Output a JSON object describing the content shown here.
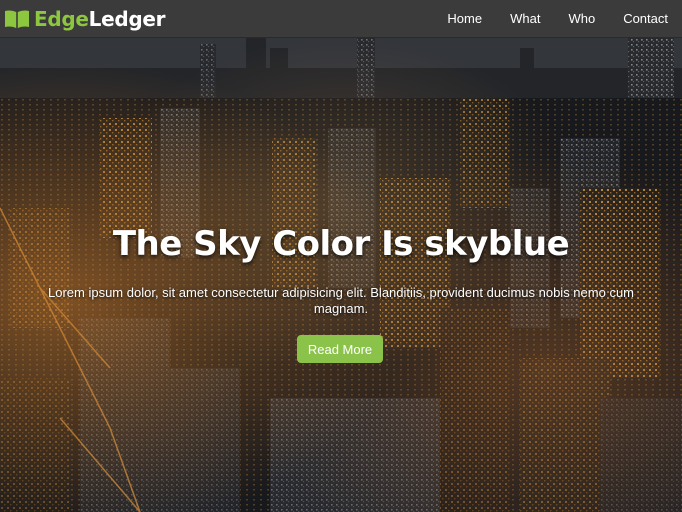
{
  "brand": {
    "icon": "open-book-icon",
    "name_part_1": "Edge",
    "name_part_2": "Ledger",
    "color_part_1": "#8dc63f",
    "color_part_2": "#ffffff"
  },
  "nav": {
    "items": [
      {
        "label": "Home"
      },
      {
        "label": "What"
      },
      {
        "label": "Who"
      },
      {
        "label": "Contact"
      }
    ]
  },
  "hero": {
    "background": "night city skyline aerial photo",
    "title": "The Sky Color Is skyblue",
    "text": "Lorem ipsum dolor, sit amet consectetur adipisicing elit. Blanditiis, provident ducimus nobis nemo cum magnam.",
    "button_label": "Read More",
    "button_color": "#8bc34a"
  }
}
